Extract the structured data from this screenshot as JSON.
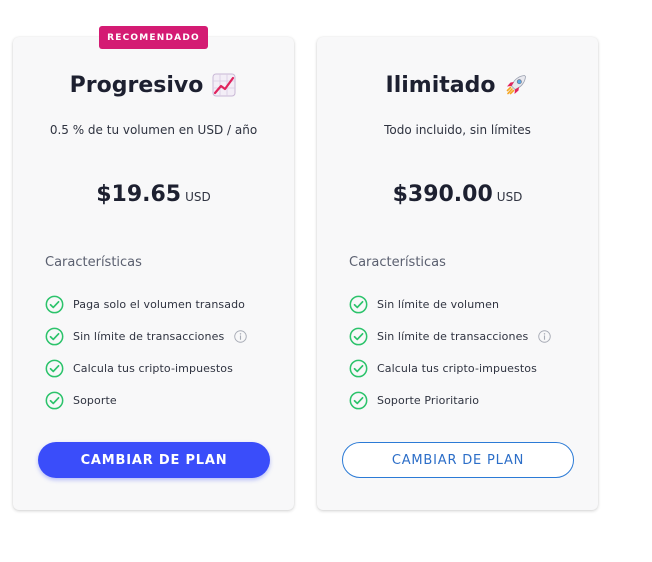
{
  "colors": {
    "badge": "#d41b73",
    "primary_button": "#3a4dfa",
    "outline_button": "#2c7bd6",
    "check": "#2cc36b"
  },
  "plans": [
    {
      "badge": "RECOMENDADO",
      "name": "Progresivo",
      "emoji_icon": "chart-increasing-icon",
      "subtitle": "0.5 % de tu volumen en USD / año",
      "price": "$19.65",
      "currency": "USD",
      "features_heading": "Características",
      "features": [
        {
          "label": "Paga solo el volumen transado"
        },
        {
          "label": "Sin límite de transacciones"
        },
        {
          "label": "Calcula tus cripto-impuestos"
        },
        {
          "label": "Soporte"
        }
      ],
      "button_label": "CAMBIAR DE PLAN"
    },
    {
      "name": "Ilimitado",
      "emoji_icon": "rocket-icon",
      "subtitle": "Todo incluido, sin límites",
      "price": "$390.00",
      "currency": "USD",
      "features_heading": "Características",
      "features": [
        {
          "label": "Sin límite de volumen"
        },
        {
          "label": "Sin límite de transacciones"
        },
        {
          "label": "Calcula tus cripto-impuestos"
        },
        {
          "label": "Soporte Prioritario"
        }
      ],
      "button_label": "CAMBIAR DE PLAN"
    }
  ]
}
